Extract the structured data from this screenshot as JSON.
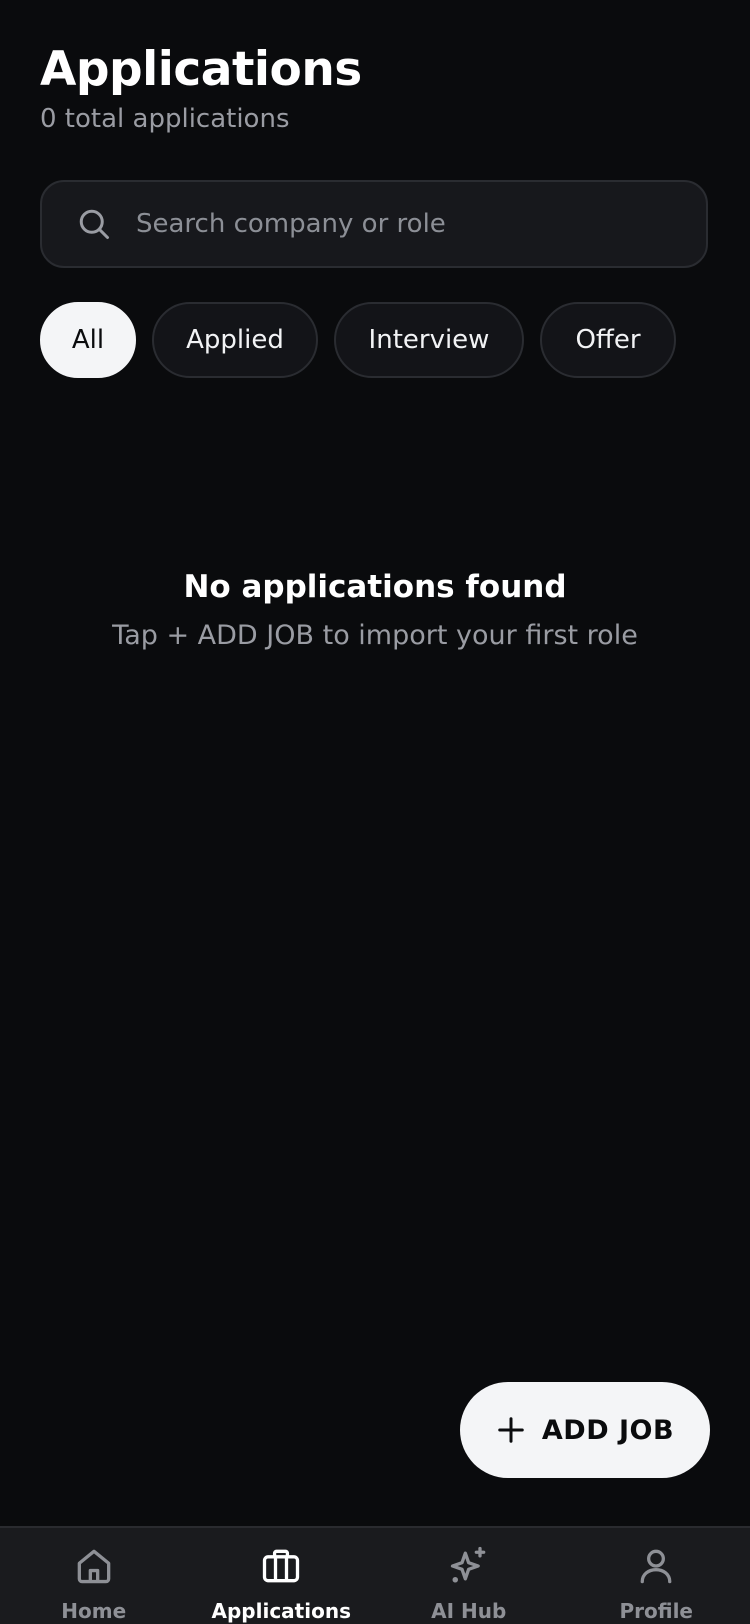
{
  "header": {
    "title": "Applications",
    "subtitle": "0 total applications"
  },
  "search": {
    "placeholder": "Search company or role",
    "value": "",
    "icon": "search-icon"
  },
  "filters": {
    "selected": "All",
    "items": [
      {
        "label": "All"
      },
      {
        "label": "Applied"
      },
      {
        "label": "Interview"
      },
      {
        "label": "Offer"
      }
    ]
  },
  "empty_state": {
    "title": "No applications found",
    "hint": "Tap + ADD JOB to import your first role"
  },
  "fab": {
    "label": "ADD JOB",
    "icon": "plus-icon"
  },
  "tabbar": {
    "active": "Applications",
    "items": [
      {
        "label": "Home",
        "icon": "home-icon"
      },
      {
        "label": "Applications",
        "icon": "briefcase-icon"
      },
      {
        "label": "AI Hub",
        "icon": "sparkles-icon"
      },
      {
        "label": "Profile",
        "icon": "user-icon"
      }
    ]
  },
  "colors": {
    "background": "#0a0b0d",
    "surface": "#17181c",
    "border": "#2a2c31",
    "accent_light": "#f4f5f7",
    "muted_text": "#9a9ca3"
  }
}
